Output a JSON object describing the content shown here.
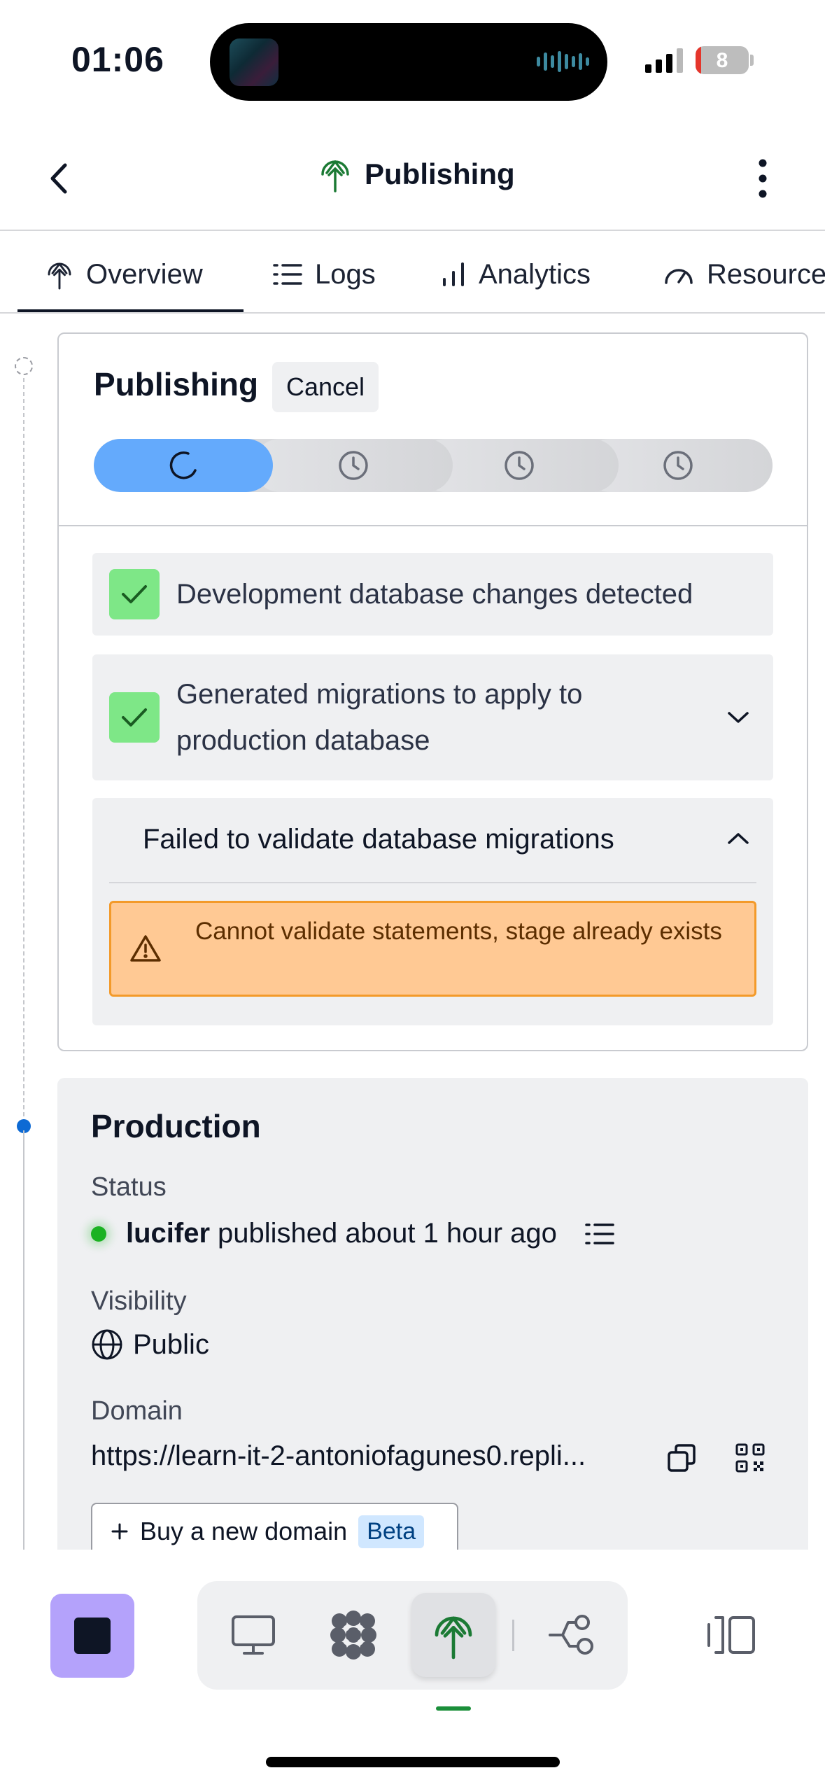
{
  "status_bar": {
    "time": "01:06",
    "battery_level": "8"
  },
  "header": {
    "title": "Publishing",
    "icons": {
      "back": "chevron-left-icon",
      "title": "deploy-antenna-icon",
      "more": "vertical-dots-icon"
    }
  },
  "tabs": [
    {
      "label": "Overview",
      "icon": "deploy-antenna-icon",
      "active": true
    },
    {
      "label": "Logs",
      "icon": "list-icon",
      "active": false
    },
    {
      "label": "Analytics",
      "icon": "bar-chart-icon",
      "active": false
    },
    {
      "label": "Resources",
      "icon": "gauge-icon",
      "active": false
    }
  ],
  "publishing": {
    "title": "Publishing",
    "cancel_label": "Cancel",
    "steps": [
      {
        "state": "in-progress",
        "icon": "spinner-icon"
      },
      {
        "state": "pending",
        "icon": "clock-icon"
      },
      {
        "state": "pending",
        "icon": "clock-icon"
      },
      {
        "state": "pending",
        "icon": "clock-icon"
      }
    ],
    "checks": [
      {
        "text": "Development database changes detected",
        "status": "done"
      },
      {
        "text": "Generated migrations to apply to production database",
        "status": "done",
        "expandable": true,
        "expanded": false
      },
      {
        "text": "Failed to validate database migrations",
        "status": "failed",
        "expandable": true,
        "expanded": true
      }
    ],
    "warning": {
      "text": "Cannot validate statements, stage already exists",
      "icon": "warning-triangle-icon"
    }
  },
  "production": {
    "title": "Production",
    "status_label": "Status",
    "status_user": "lucifer",
    "status_text": "published about 1 hour ago",
    "visibility_label": "Visibility",
    "visibility_value": "Public",
    "domain_label": "Domain",
    "domain_value": "https://learn-it-2-antoniofagunes0.repli...",
    "buy_domain_label": "Buy a new domain",
    "beta_label": "Beta"
  },
  "bottom_nav": {
    "items": [
      {
        "name": "preview",
        "icon": "monitor-icon"
      },
      {
        "name": "agent",
        "icon": "agent-icon"
      },
      {
        "name": "publishing",
        "icon": "deploy-antenna-icon",
        "active": true
      },
      {
        "name": "git",
        "icon": "branch-icon"
      }
    ]
  },
  "colors": {
    "accent_blue": "#64aafc",
    "check_green": "#7ee787",
    "warning_bg": "#ffc994",
    "warning_border": "#f39a2a",
    "stop_purple": "#b4a2fb",
    "status_green": "#1bb222"
  }
}
